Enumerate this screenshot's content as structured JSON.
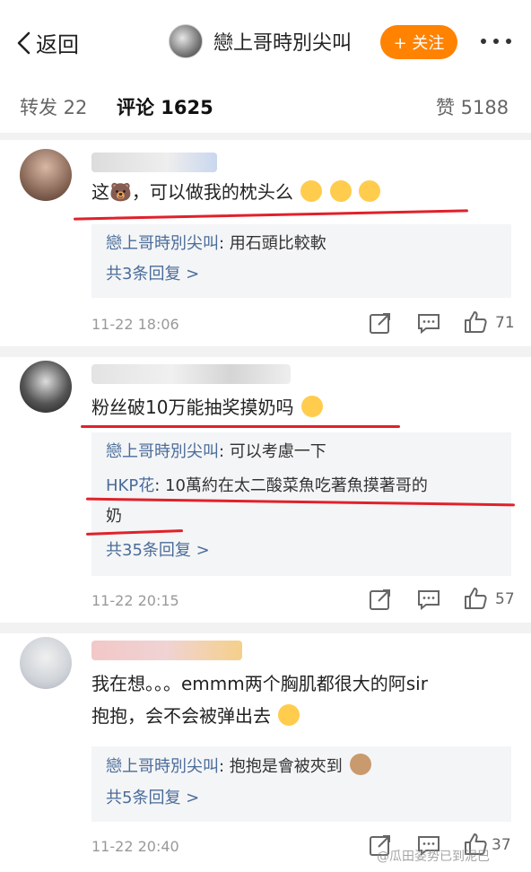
{
  "header": {
    "back_label": "返回",
    "account_name": "戀上哥時別尖叫",
    "follow_label": "+ 关注"
  },
  "tabs": [
    {
      "label": "转发 22"
    },
    {
      "label": "评论 1625"
    },
    {
      "label": "赞 5188"
    }
  ],
  "comments": [
    {
      "text": "这🐻，可以做我的枕头么",
      "replies": [
        {
          "user": "戀上哥時別尖叫",
          "text": ": 用石頭比較軟"
        }
      ],
      "more_replies": "共3条回复 >",
      "time": "11-22 18:06",
      "likes": "71"
    },
    {
      "text": "粉丝破10万能抽奖摸奶吗",
      "replies": [
        {
          "user": "戀上哥時別尖叫",
          "text": ": 可以考慮一下"
        },
        {
          "user": "HKP花",
          "text": ": 10萬約在太二酸菜魚吃著魚摸著哥的",
          "cont": "奶"
        }
      ],
      "more_replies": "共35条回复 >",
      "time": "11-22 20:15",
      "likes": "57"
    },
    {
      "text": "我在想。。。emmm两个胸肌都很大的阿sir",
      "text2": "抱抱，会不会被弹出去",
      "replies": [
        {
          "user": "戀上哥時別尖叫",
          "text": ": 抱抱是會被夾到"
        }
      ],
      "more_replies": "共5条回复 >",
      "time": "11-22 20:40",
      "likes": "37"
    }
  ],
  "colors": {
    "accent": "#ff8200",
    "link": "#4a6c99",
    "highlight": "#e0212a"
  },
  "watermark": "@瓜田姿势已到泥巴"
}
